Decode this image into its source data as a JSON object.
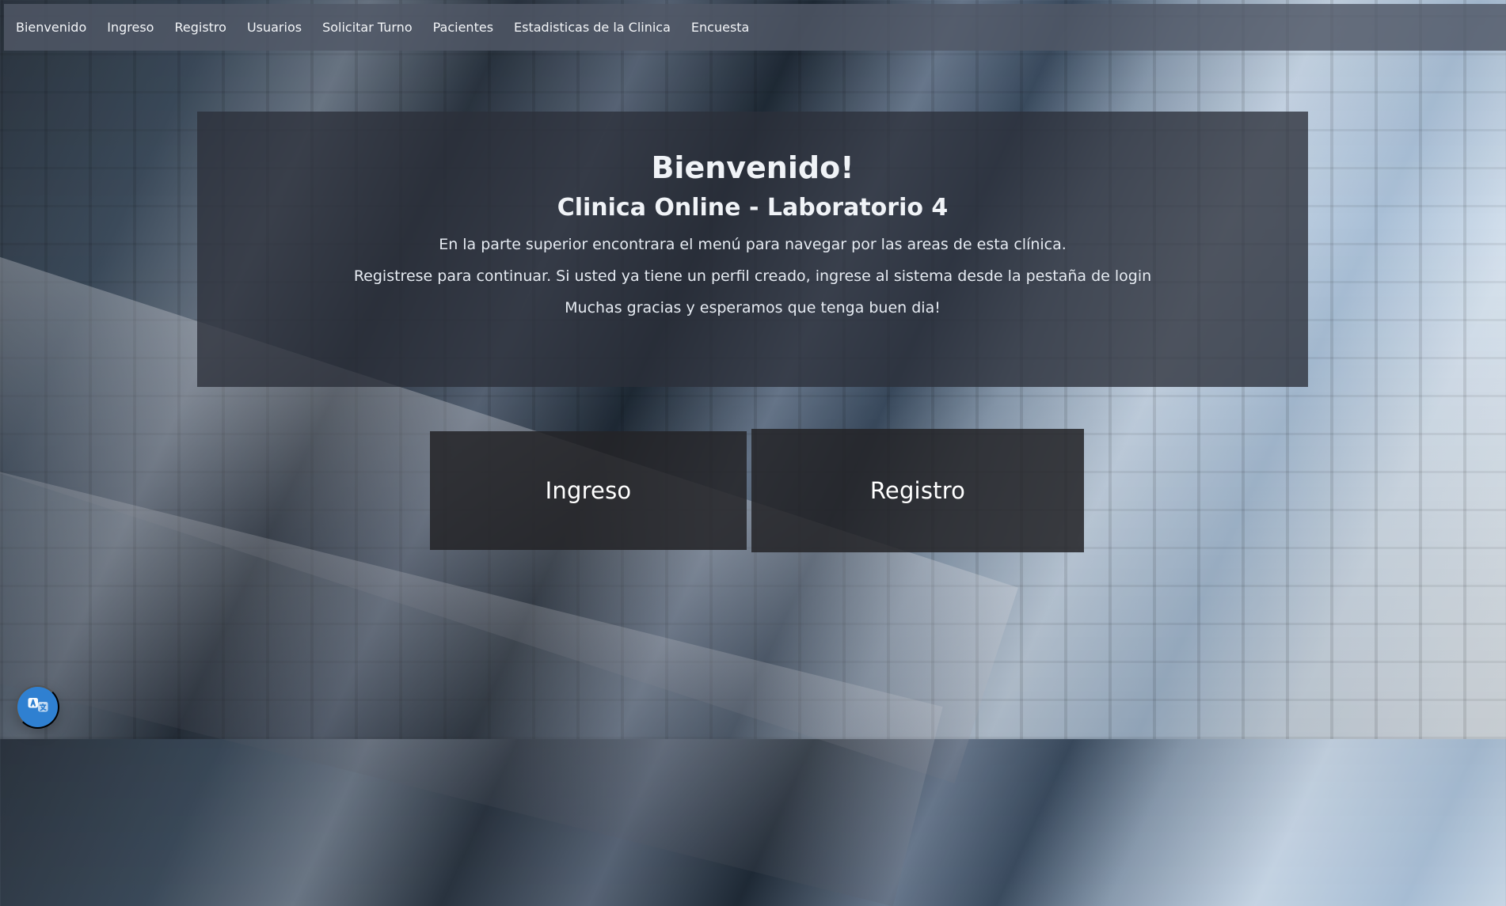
{
  "nav": {
    "items": [
      {
        "label": "Bienvenido"
      },
      {
        "label": "Ingreso"
      },
      {
        "label": "Registro"
      },
      {
        "label": "Usuarios"
      },
      {
        "label": "Solicitar Turno"
      },
      {
        "label": "Pacientes"
      },
      {
        "label": "Estadisticas de la Clinica"
      },
      {
        "label": "Encuesta"
      }
    ]
  },
  "welcome": {
    "title": "Bienvenido!",
    "subtitle": "Clinica Online - Laboratorio 4",
    "lines": [
      "En la parte superior encontrara el menú para navegar por las areas de esta clínica.",
      "Registrese para continuar. Si usted ya tiene un perfil creado, ingrese al sistema desde la pestaña de login",
      "Muchas gracias y esperamos que tenga buen dia!"
    ]
  },
  "actions": {
    "ingreso_label": "Ingreso",
    "registro_label": "Registro"
  },
  "ui": {
    "accent": "#2f80d1",
    "translate_icon": "translate-icon"
  }
}
